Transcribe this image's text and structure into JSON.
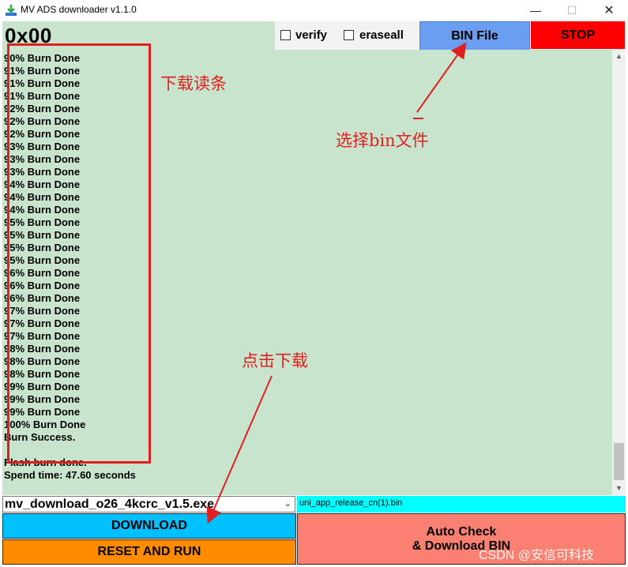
{
  "window": {
    "title": "MV ADS downloader v1.1.0",
    "minimize": "—",
    "maximize": "☐",
    "close": "✕"
  },
  "toolbar": {
    "address": "0x00",
    "verify_label": "verify",
    "verify_checked": false,
    "eraseall_label": "eraseall",
    "eraseall_checked": false,
    "bin_file_label": "BIN File",
    "stop_label": "STOP"
  },
  "log": {
    "lines": [
      "90% Burn Done",
      "91% Burn Done",
      "91% Burn Done",
      "91% Burn Done",
      "92% Burn Done",
      "92% Burn Done",
      "92% Burn Done",
      "93% Burn Done",
      "93% Burn Done",
      "93% Burn Done",
      "94% Burn Done",
      "94% Burn Done",
      "94% Burn Done",
      "95% Burn Done",
      "95% Burn Done",
      "95% Burn Done",
      "95% Burn Done",
      "96% Burn Done",
      "96% Burn Done",
      "96% Burn Done",
      "97% Burn Done",
      "97% Burn Done",
      "97% Burn Done",
      "98% Burn Done",
      "98% Burn Done",
      "98% Burn Done",
      "99% Burn Done",
      "99% Burn Done",
      "99% Burn Done",
      "100% Burn Done",
      "Burn Success.",
      "",
      "Flash burn done.",
      "Spend time: 47.60 seconds"
    ]
  },
  "bottom": {
    "exe_select_value": "mv_download_o26_4kcrc_v1.5.exe",
    "bin_filename": "uni_app_release_cn(1).bin",
    "download_label": "DOWNLOAD",
    "reset_run_label": "RESET AND RUN",
    "auto_check_line1": "Auto Check",
    "auto_check_line2": "& Download BIN"
  },
  "annotations": {
    "progress_note": "下载读条",
    "select_bin_note": "选择bin文件",
    "click_download_note": "点击下载",
    "color": "#e02020"
  },
  "watermark": "CSDN @安信可科技",
  "colors": {
    "log_bg": "#c9e4cd",
    "bin_button": "#6b9ef0",
    "stop_button": "#ff0000",
    "download_button": "#00bfff",
    "reset_button": "#ff8c00",
    "auto_button": "#fa8072",
    "bin_name_bg": "#00ffff"
  }
}
